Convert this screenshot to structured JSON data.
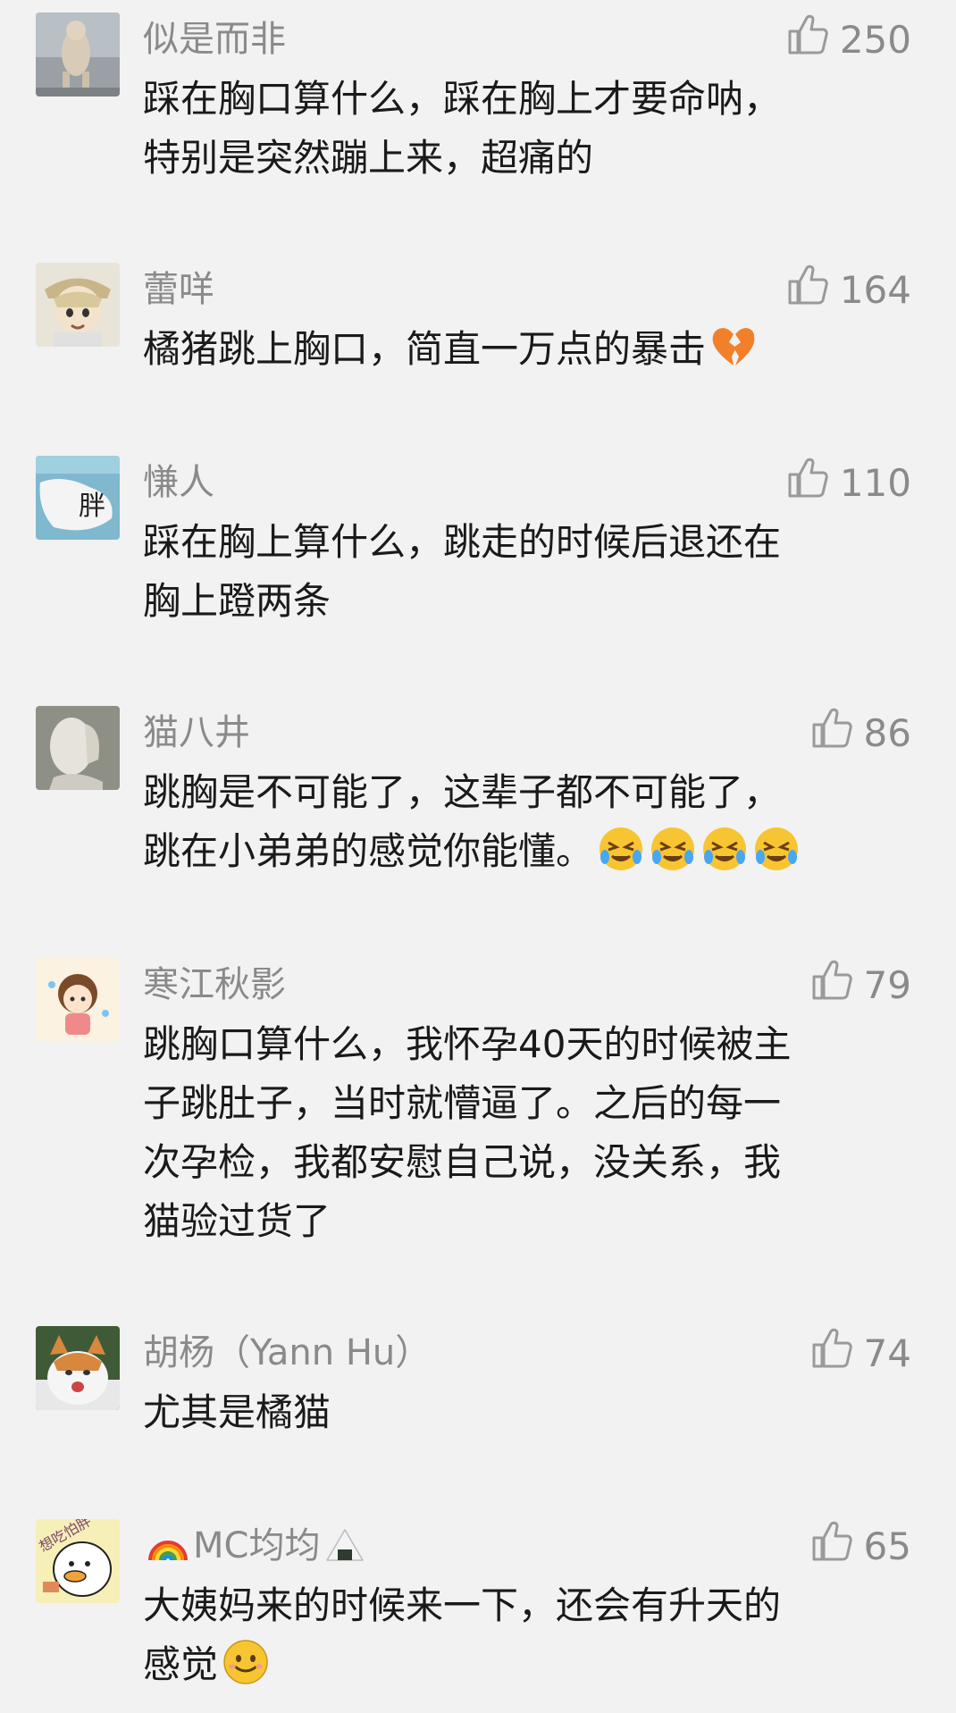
{
  "comments": [
    {
      "username": "似是而非",
      "likes": "250",
      "lines": [
        "踩在胸口算什么，踩在胸上才要命呐，",
        "特别是突然蹦上来，超痛的"
      ],
      "avatar": "avatar-cat-standing"
    },
    {
      "username": "蕾咩",
      "likes": "164",
      "lines": [
        "橘猪跳上胸口，简直一万点的暴击"
      ],
      "trailing_emoji": "broken-heart-emoji",
      "avatar": "avatar-anime-girl"
    },
    {
      "username": "慊人",
      "likes": "110",
      "lines": [
        "踩在胸上算什么，跳走的时候后退还在",
        "胸上蹬两条"
      ],
      "avatar": "avatar-fat-cat-paw"
    },
    {
      "username": "猫八井",
      "likes": "86",
      "lines": [
        "跳胸是不可能了，这辈子都不可能了，",
        "跳在小弟弟的感觉你能懂。"
      ],
      "trailing_emoji_repeat": 4,
      "trailing_emoji": "crying-laughing-emoji",
      "avatar": "avatar-statue"
    },
    {
      "username": "寒江秋影",
      "likes": "79",
      "lines": [
        "跳胸口算什么，我怀孕40天的时候被主",
        "子跳肚子，当时就懵逼了。之后的每一",
        "次孕检，我都安慰自己说，没关系，我",
        "猫验过货了"
      ],
      "avatar": "avatar-chibi-girl"
    },
    {
      "username": "胡杨（Yann Hu）",
      "likes": "74",
      "lines": [
        "尤其是橘猫"
      ],
      "avatar": "avatar-cat-photo"
    },
    {
      "username_parts": [
        "MC均均"
      ],
      "username_icons": [
        "rainbow-icon",
        "rice-ball-icon"
      ],
      "likes": "65",
      "lines": [
        "大姨妈来的时候来一下，还会有升天的",
        "感觉"
      ],
      "trailing_emoji": "smile-emoji",
      "avatar": "avatar-duck-cartoon",
      "avatar_text": "想吃怕胖"
    }
  ]
}
